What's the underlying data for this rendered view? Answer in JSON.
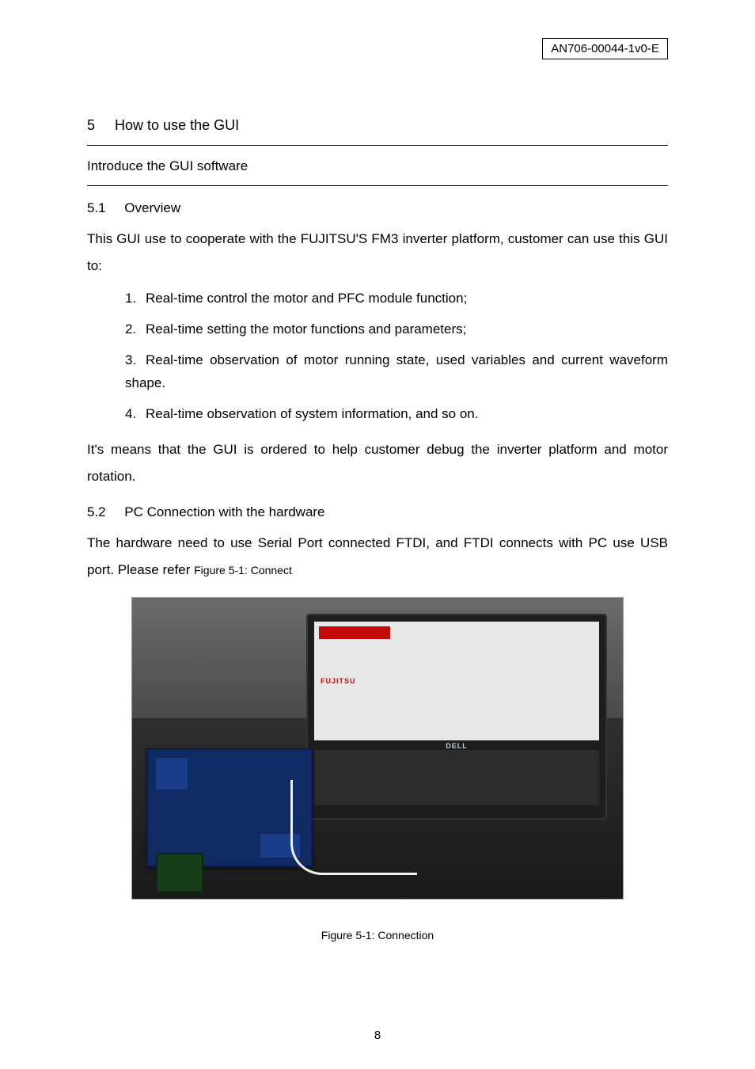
{
  "doc_number": "AN706-00044-1v0-E",
  "section": {
    "number": "5",
    "title": "How to use the GUI"
  },
  "intro_line": "Introduce the GUI software",
  "sub1": {
    "number": "5.1",
    "title": "Overview",
    "lead": "This GUI use to cooperate with the FUJITSU'S FM3 inverter platform, customer can use this GUI to:",
    "items": [
      "Real-time control the motor and PFC module function;",
      "Real-time setting the motor functions and parameters;",
      "Real-time observation of motor running state, used variables and current waveform shape.",
      "Real-time observation of system information, and so on."
    ],
    "tail": "It's means that the GUI is ordered to help customer debug the inverter platform and motor rotation."
  },
  "sub2": {
    "number": "5.2",
    "title": "PC Connection with the hardware",
    "body_a": "The hardware need to use Serial Port connected FTDI, and FTDI connects with PC use USB port. Please refer ",
    "body_ref": "Figure 5-1: Connect"
  },
  "figure": {
    "fujitsu_label": "FUJITSU",
    "dell_label": "DELL",
    "caption": "Figure 5-1: Connection"
  },
  "page_number": "8"
}
